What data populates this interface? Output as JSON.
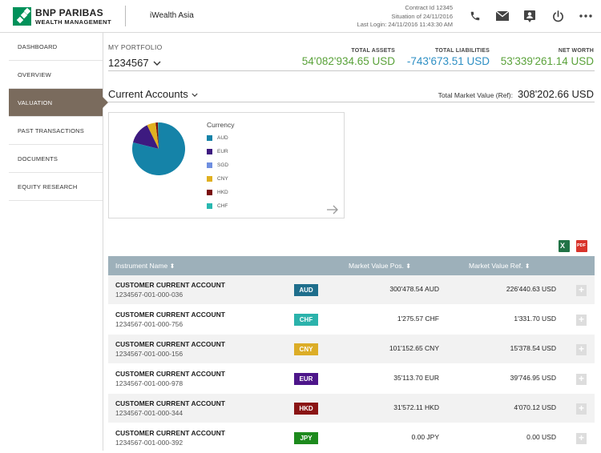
{
  "header": {
    "logo_line1": "BNP PARIBAS",
    "logo_line2": "WEALTH MANAGEMENT",
    "app_name": "iWealth Asia",
    "contract": "Contract Id 12345",
    "situation": "Situation of 24/11/2016",
    "last_login": "Last Login: 24/11/2016 11:43:30 AM",
    "icons": [
      "phone-icon",
      "mail-icon",
      "contact-card-icon",
      "power-icon",
      "more-icon"
    ]
  },
  "sidebar": {
    "items": [
      {
        "label": "DASHBOARD"
      },
      {
        "label": "OVERVIEW"
      },
      {
        "label": "VALUATION",
        "active": true
      },
      {
        "label": "PAST TRANSACTIONS"
      },
      {
        "label": "DOCUMENTS"
      },
      {
        "label": "EQUITY RESEARCH"
      }
    ]
  },
  "portfolio": {
    "label": "MY PORTFOLIO",
    "selected": "1234567",
    "total_assets_label": "TOTAL ASSETS",
    "total_assets": "54'082'934.65 USD",
    "total_liabilities_label": "TOTAL LIABILITIES",
    "total_liabilities": "-743'673.51 USD",
    "net_worth_label": "NET WORTH",
    "net_worth": "53'339'261.14 USD"
  },
  "accounts": {
    "title": "Current Accounts",
    "tmv_label": "Total Market Value (Ref):",
    "tmv_value": "308'202.66 USD"
  },
  "chart_data": {
    "type": "pie",
    "title": "Currency",
    "categories": [
      "AUD",
      "EUR",
      "SGD",
      "CNY",
      "HKD",
      "CHF"
    ],
    "values": [
      226440.63,
      39746.95,
      0,
      15378.54,
      4070.12,
      1331.7
    ],
    "colors": [
      "#1583a8",
      "#3d1a80",
      "#6f8fe0",
      "#e0b020",
      "#7a0e0e",
      "#29b8b0"
    ]
  },
  "table": {
    "columns": [
      "Instrument Name",
      "Market Value Pos.",
      "Market Value Ref."
    ],
    "rows": [
      {
        "name": "CUSTOMER CURRENT ACCOUNT",
        "number": "1234567-001-000-036",
        "ccy": "AUD",
        "color": "#1f6e8c",
        "pos": "300'478.54 AUD",
        "ref": "226'440.63 USD"
      },
      {
        "name": "CUSTOMER CURRENT ACCOUNT",
        "number": "1234567-001-000-756",
        "ccy": "CHF",
        "color": "#2bb2ab",
        "pos": "1'275.57 CHF",
        "ref": "1'331.70 USD"
      },
      {
        "name": "CUSTOMER CURRENT ACCOUNT",
        "number": "1234567-001-000-156",
        "ccy": "CNY",
        "color": "#dcad27",
        "pos": "101'152.65 CNY",
        "ref": "15'378.54 USD"
      },
      {
        "name": "CUSTOMER CURRENT ACCOUNT",
        "number": "1234567-001-000-978",
        "ccy": "EUR",
        "color": "#4d168a",
        "pos": "35'113.70 EUR",
        "ref": "39'746.95 USD"
      },
      {
        "name": "CUSTOMER CURRENT ACCOUNT",
        "number": "1234567-001-000-344",
        "ccy": "HKD",
        "color": "#8a1414",
        "pos": "31'572.11 HKD",
        "ref": "4'070.12 USD"
      },
      {
        "name": "CUSTOMER CURRENT ACCOUNT",
        "number": "1234567-001-000-392",
        "ccy": "JPY",
        "color": "#1d8a1d",
        "pos": "0.00 JPY",
        "ref": "0.00 USD"
      }
    ]
  }
}
